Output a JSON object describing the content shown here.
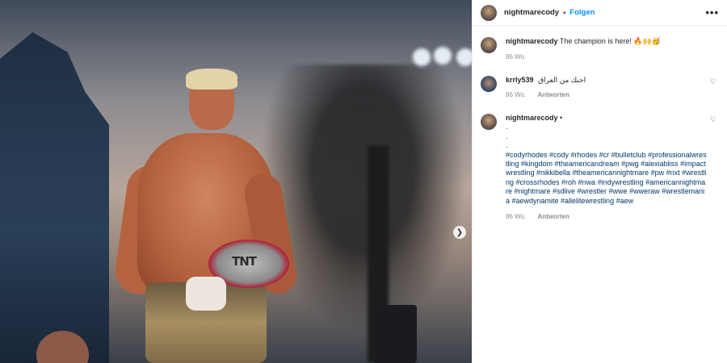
{
  "photo": {
    "belt_text": "TNT",
    "next_icon": "chevron-right-icon"
  },
  "header": {
    "username": "nightmarecody",
    "separator": "•",
    "follow_label": "Folgen",
    "more_icon": "•••"
  },
  "caption": {
    "username": "nightmarecody",
    "text": "The champion is here!",
    "emojis": "🔥🙌🥳",
    "time": "86 Wo."
  },
  "comments": [
    {
      "username": "krrly539",
      "text": "احبك من العراق",
      "time": "86 Wo.",
      "reply_label": "Antworten"
    },
    {
      "username": "nightmarecody",
      "dot_line": "•",
      "lines": [
        ".",
        ".",
        "."
      ],
      "hashtags": "#codyrhodes #cody #rhodes #cr #bulletclub #professionalwrestling #kingdom #theamericandream #pwg #alexiabliss #impactwrestling #nikkibella #theamericannightmare #pw #nxt #wrestling #crossrhodes #roh #nwa #indywrestling #americannightmare #nightmare #sdlive #wrestler #wwe #wweraw #wrestlemania #aewdynamite #allelitewrestling #aew",
      "time": "86 Wo.",
      "reply_label": "Antworten"
    }
  ],
  "heart_icon": "♡"
}
